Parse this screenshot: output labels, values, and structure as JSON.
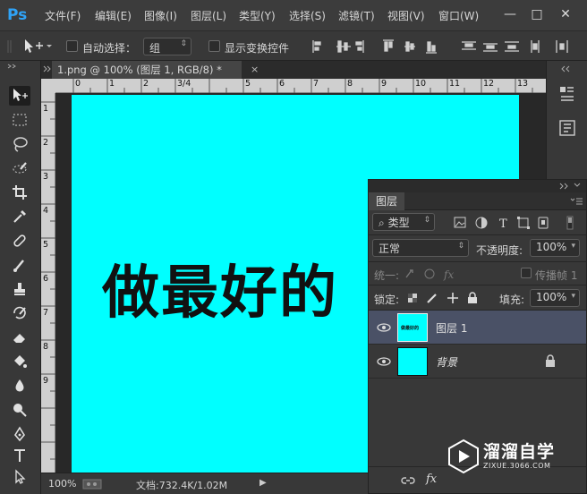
{
  "app": {
    "logo": "Ps"
  },
  "menu": [
    "文件(F)",
    "编辑(E)",
    "图像(I)",
    "图层(L)",
    "类型(Y)",
    "选择(S)",
    "滤镜(T)",
    "视图(V)",
    "窗口(W)"
  ],
  "window_controls": {
    "minimize": "—",
    "maximize": "□",
    "close": "✕"
  },
  "options": {
    "auto_select_label": "自动选择：",
    "auto_select_checked": false,
    "auto_select_target": "组",
    "show_transform_label": "显示变换控件",
    "show_transform_checked": false
  },
  "document": {
    "tab_title": "1.png @ 100% (图层 1, RGB/8) *",
    "close_glyph": "×",
    "ruler_top": [
      "0",
      "1",
      "2",
      "3/4",
      "5",
      "6",
      "7",
      "8",
      "9",
      "10",
      "11",
      "12",
      "13"
    ],
    "ruler_left": [
      "1",
      "2",
      "3",
      "4",
      "5",
      "6",
      "7",
      "8",
      "9"
    ],
    "background_color": "#00ffff",
    "canvas_text": "做最好的"
  },
  "status": {
    "zoom": "100%",
    "doc_size": "文档:732.4K/1.02M"
  },
  "layers_panel": {
    "tab": "图层",
    "filter_kind": "类型",
    "blend_mode": "正常",
    "opacity_label": "不透明度:",
    "opacity_value": "100%",
    "unify_label": "统一:",
    "propagate_label": "传播帧 1",
    "lock_label": "锁定:",
    "fill_label": "填充:",
    "fill_value": "100%",
    "layers": [
      {
        "name": "图层 1",
        "selected": true,
        "thumb_text": "做最好的"
      },
      {
        "name": "背景",
        "selected": false,
        "locked": true,
        "thumb_text": ""
      }
    ],
    "footer_fx": "fx"
  },
  "watermark": {
    "title": "溜溜自学",
    "url": "ZIXUE.3066.COM"
  },
  "colors": {
    "accent": "#2fa3f7",
    "canvas": "#00ffff",
    "selected_layer": "#4a5166"
  }
}
